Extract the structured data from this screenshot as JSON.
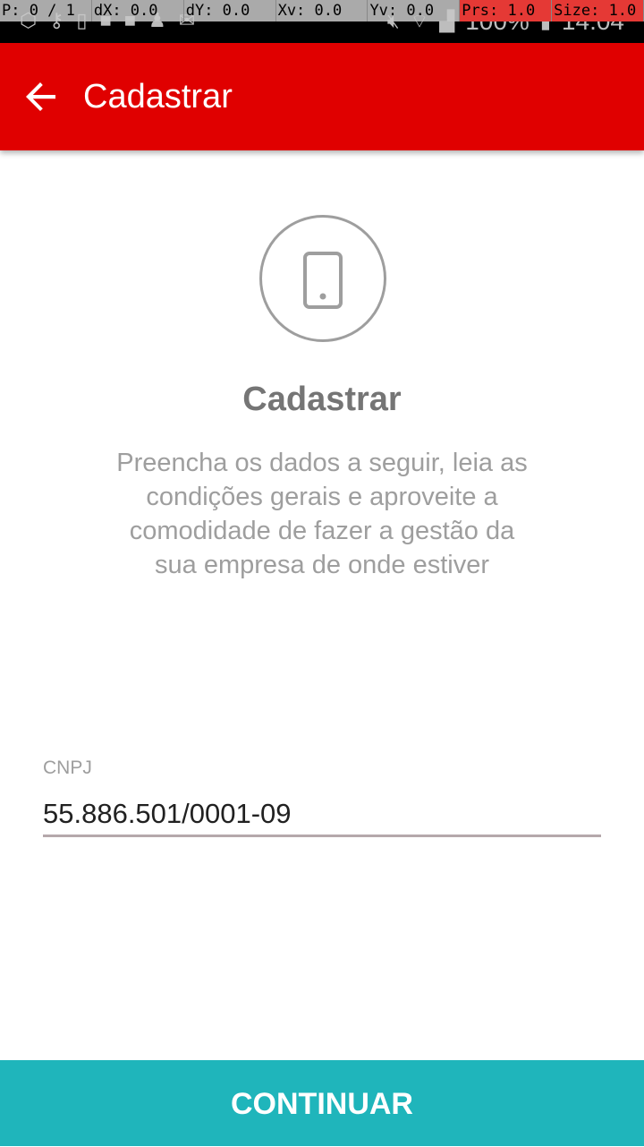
{
  "status_bar": {
    "battery": "100%",
    "time": "14:04"
  },
  "debug_overlay": {
    "p": "P: 0 / 1",
    "dx": "dX: 0.0",
    "dy": "dY: 0.0",
    "xv": "Xv: 0.0",
    "yv": "Yv: 0.0",
    "prs": "Prs: 1.0",
    "size": "Size: 1.0"
  },
  "app_bar": {
    "title": "Cadastrar",
    "back_icon": "arrow-back-icon",
    "color": "#e00000"
  },
  "main": {
    "icon": "smartphone-icon",
    "heading": "Cadastrar",
    "description": "Preencha os dados a seguir, leia as condições gerais e aproveite a comodidade de fazer a gestão da sua empresa de onde estiver"
  },
  "form": {
    "cnpj_label": "CNPJ",
    "cnpj_value": "55.886.501/0001-09"
  },
  "footer": {
    "continue_label": "CONTINUAR",
    "color": "#1fb5bb"
  }
}
